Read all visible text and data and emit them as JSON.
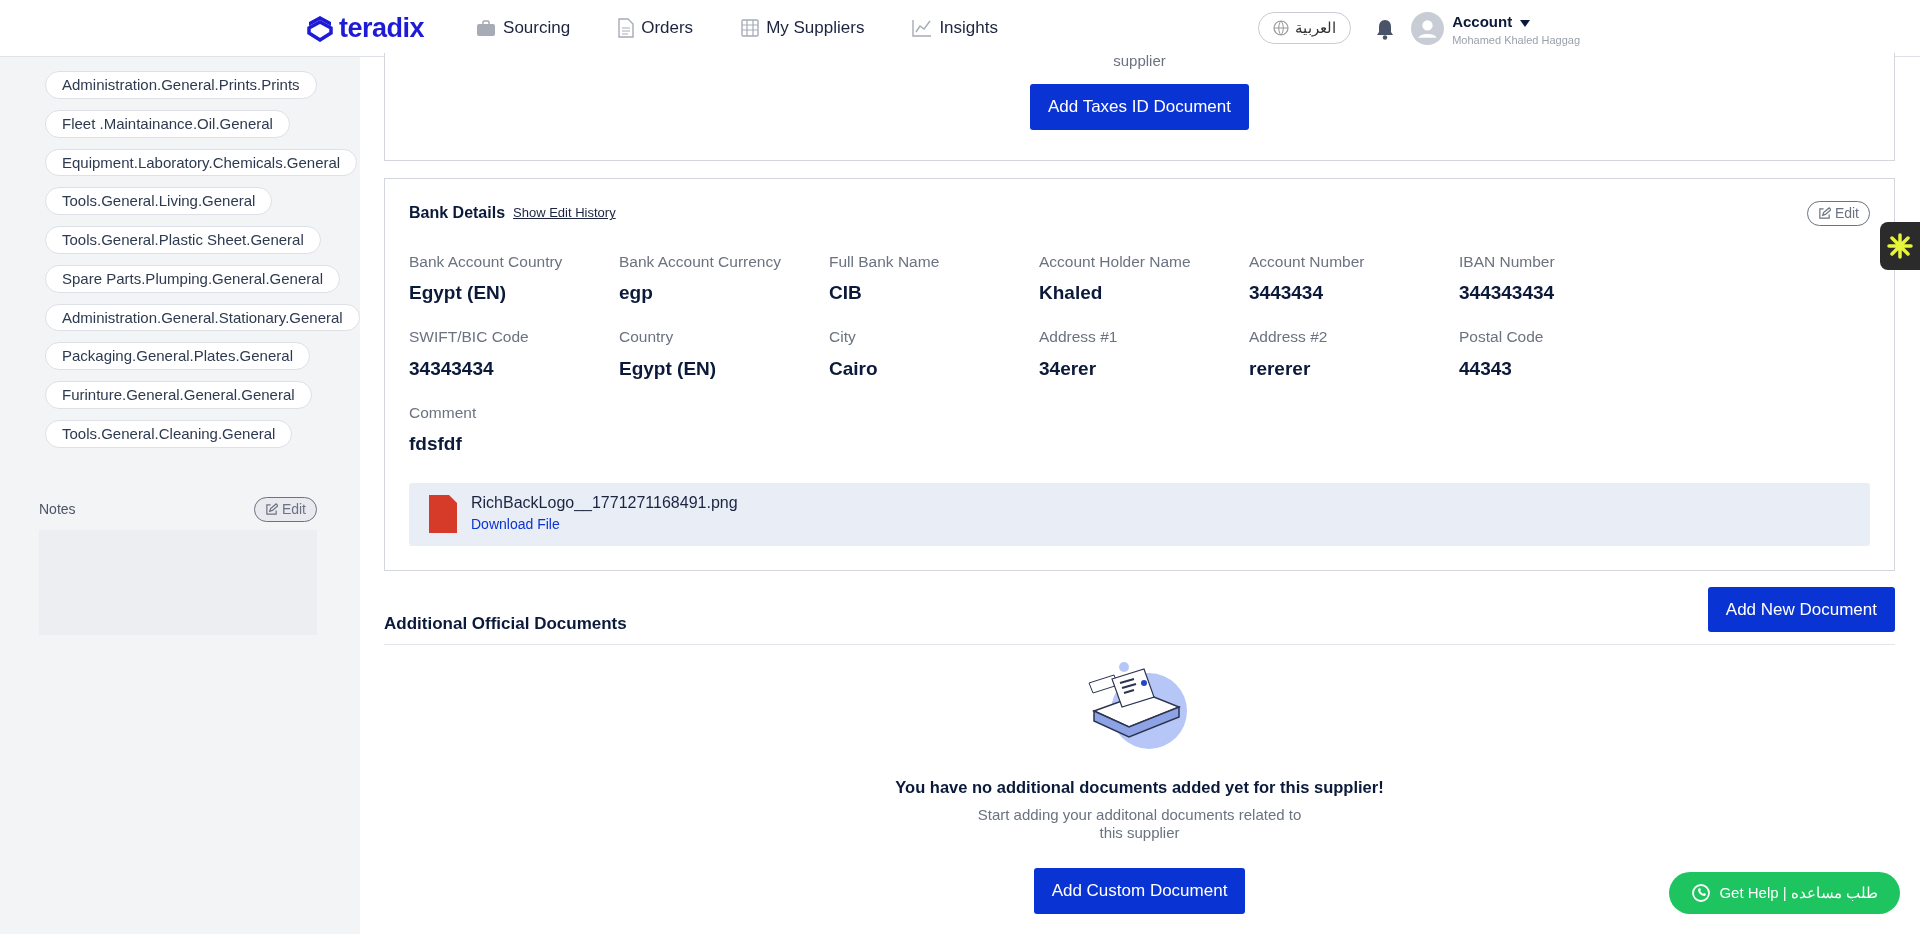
{
  "navbar": {
    "logo": "teradix",
    "links": [
      {
        "label": "Sourcing"
      },
      {
        "label": "Orders"
      },
      {
        "label": "My Suppliers"
      },
      {
        "label": "Insights"
      }
    ],
    "language": "العربية",
    "account": {
      "label": "Account",
      "name": "Mohamed Khaled Haggag"
    }
  },
  "sidebar": {
    "categories": [
      "Administration.General.Prints.Prints",
      "Fleet .Maintainance.Oil.General",
      "Equipment.Laboratory.Chemicals.General",
      "Tools.General.Living.General",
      "Tools.General.Plastic Sheet.General",
      "Spare Parts.Plumping.General.General",
      "Administration.General.Stationary.General",
      "Packaging.General.Plates.General",
      "Furinture.General.General.General",
      "Tools.General.Cleaning.General"
    ],
    "notes": {
      "title": "Notes",
      "edit": "Edit"
    }
  },
  "taxes_card": {
    "text": "supplier",
    "button": "Add Taxes ID Document"
  },
  "bank_details": {
    "title": "Bank Details",
    "history_link": "Show Edit History",
    "edit": "Edit",
    "fields": [
      {
        "label": "Bank Account Country",
        "value": "Egypt (EN)"
      },
      {
        "label": "Bank Account Currency",
        "value": "egp"
      },
      {
        "label": "Full Bank Name",
        "value": "CIB"
      },
      {
        "label": "Account Holder Name",
        "value": "Khaled"
      },
      {
        "label": "Account Number",
        "value": "3443434"
      },
      {
        "label": "IBAN Number",
        "value": "344343434"
      },
      {
        "label": "SWIFT/BIC Code",
        "value": "34343434"
      },
      {
        "label": "Country",
        "value": "Egypt (EN)"
      },
      {
        "label": "City",
        "value": "Cairo"
      },
      {
        "label": "Address #1",
        "value": "34erer"
      },
      {
        "label": "Address #2",
        "value": "rererer"
      },
      {
        "label": "Postal Code",
        "value": "44343"
      },
      {
        "label": "Comment",
        "value": "fdsfdf"
      }
    ],
    "file": {
      "name": "RichBackLogo__1771271168491.png",
      "link": "Download File"
    }
  },
  "additional_documents": {
    "title": "Additional Official Documents",
    "add_button": "Add New Document",
    "empty_title": "You have no additional documents added yet for this supplier!",
    "empty_text": "Start adding your additonal documents related to this supplier",
    "custom_button": "Add Custom Document"
  },
  "help_button": "Get Help | طلب مساعده"
}
